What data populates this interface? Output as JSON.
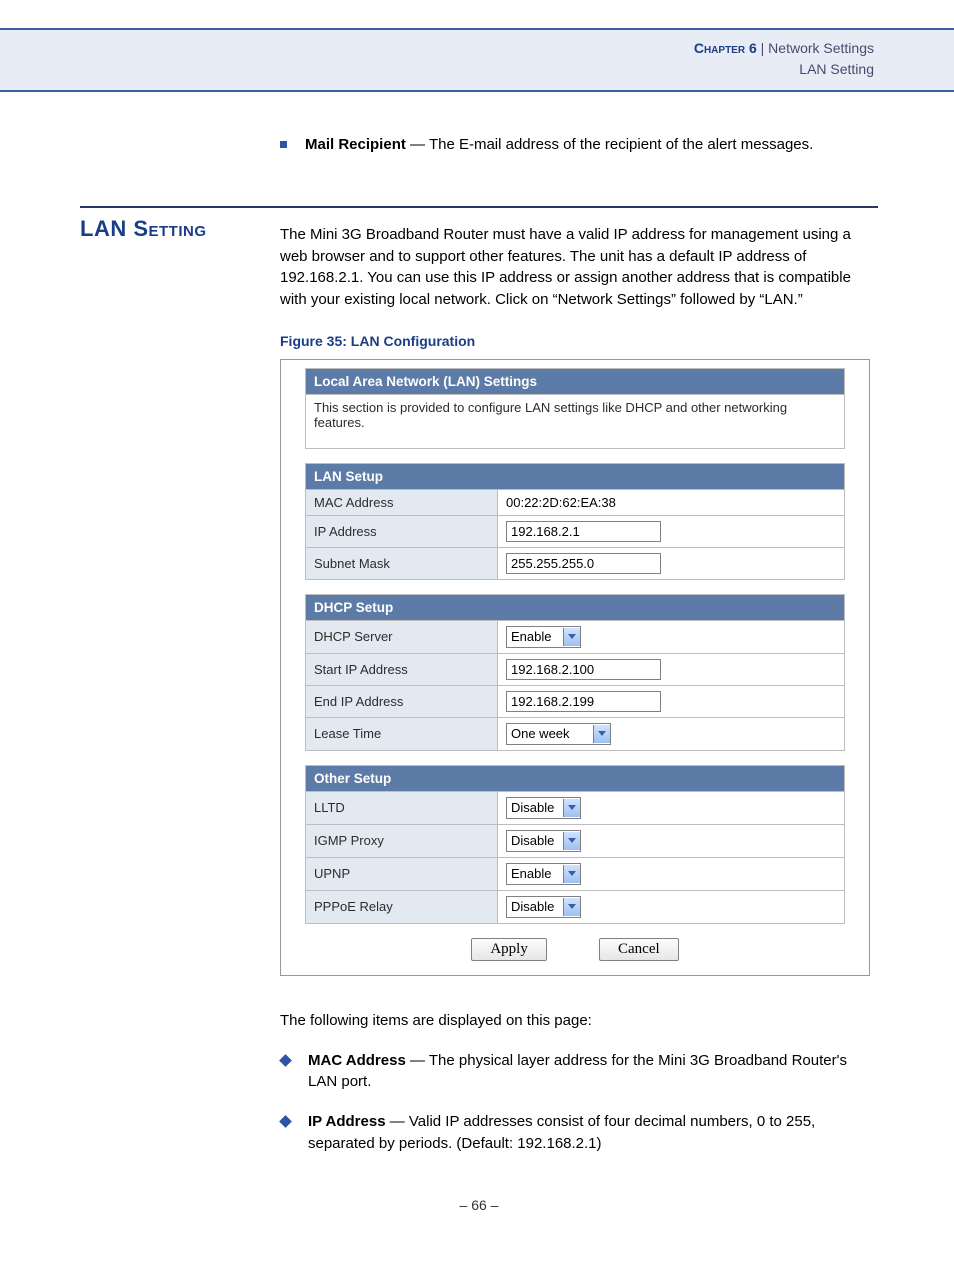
{
  "header": {
    "chapter_label": "Chapter 6",
    "separator": "  |  ",
    "section1": "Network Settings",
    "section2": "LAN Setting"
  },
  "mail_recipient": {
    "term": "Mail Recipient",
    "dash": " — ",
    "desc": "The E-mail address of the recipient of the alert messages."
  },
  "heading": "LAN Setting",
  "intro": "The Mini 3G Broadband Router must have a valid IP address for management using a web browser and to support other features. The unit has a default IP address of 192.168.2.1. You can use this IP address or assign another address that is compatible with your existing local network. Click on “Network Settings” followed by “LAN.”",
  "fig_caption": "Figure 35:  LAN Configuration",
  "screen": {
    "title": "Local Area Network (LAN) Settings",
    "desc": "This section is provided to configure LAN settings like DHCP and other networking features.",
    "lan_setup": {
      "header": "LAN Setup",
      "mac_label": "MAC Address",
      "mac_value": "00:22:2D:62:EA:38",
      "ip_label": "IP Address",
      "ip_value": "192.168.2.1",
      "subnet_label": "Subnet Mask",
      "subnet_value": "255.255.255.0"
    },
    "dhcp_setup": {
      "header": "DHCP Setup",
      "server_label": "DHCP Server",
      "server_value": "Enable",
      "start_label": "Start IP Address",
      "start_value": "192.168.2.100",
      "end_label": "End IP Address",
      "end_value": "192.168.2.199",
      "lease_label": "Lease Time",
      "lease_value": "One week"
    },
    "other_setup": {
      "header": "Other Setup",
      "lltd_label": "LLTD",
      "lltd_value": "Disable",
      "igmp_label": "IGMP Proxy",
      "igmp_value": "Disable",
      "upnp_label": "UPNP",
      "upnp_value": "Enable",
      "pppoe_label": "PPPoE Relay",
      "pppoe_value": "Disable"
    },
    "apply_label": "Apply",
    "cancel_label": "Cancel"
  },
  "after_intro": "The following items are displayed on this page:",
  "items": {
    "mac": {
      "term": "MAC Address",
      "dash": " — ",
      "desc": "The physical layer address for the Mini 3G Broadband Router's LAN port."
    },
    "ip": {
      "term": "IP Address",
      "dash": " — ",
      "desc": "Valid IP addresses consist of four decimal numbers, 0 to 255, separated by periods. (Default: 192.168.2.1)"
    }
  },
  "page_number": "–  66  –"
}
